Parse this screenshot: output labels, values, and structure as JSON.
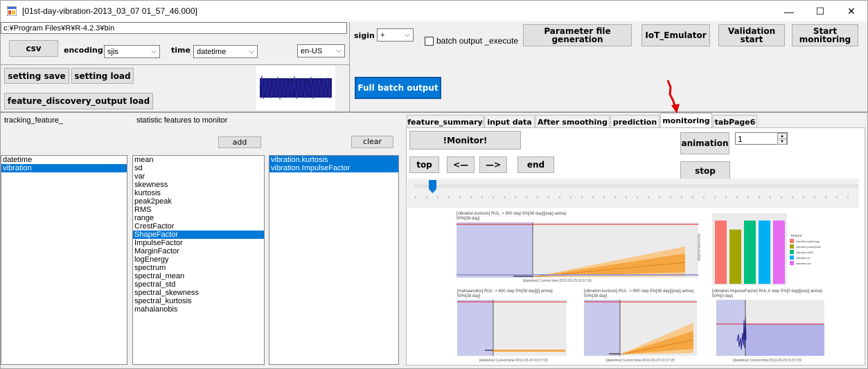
{
  "window": {
    "title": "[01st-day-vibration-2013_03_07 01_57_46.000]"
  },
  "path": {
    "value": "c:¥Program Files¥R¥R-4.2.3¥bin"
  },
  "buttons": {
    "csv": "csv",
    "setting_save": "setting save",
    "setting_load": "setting load",
    "feature_discovery_load": "feature_discovery_output load",
    "full_batch_output": "Full batch output",
    "parameter_file": "Parameter file generation",
    "iot_emulator": "IoT_Emulator",
    "validation_start": "Validation start",
    "start_monitoring": "Start monitoring",
    "add": "add",
    "clear": "clear",
    "monitor": "!Monitor!",
    "top": "top",
    "prev": "<—",
    "next": "—>",
    "end": "end",
    "animation": "animation",
    "stop": "stop"
  },
  "labels": {
    "encoding": "encoding",
    "time": "time",
    "sigin": "sigin",
    "batch_output": "batch output _execute",
    "tracking_feature": "tracking_feature_",
    "statistic_features": "statistic features to monitor"
  },
  "selects": {
    "encoding": "sjis",
    "time": "datetime",
    "locale": "en-US",
    "sigin": "+"
  },
  "tabs": [
    "feature_summary",
    "input data",
    "After smoothing",
    "prediction",
    "monitoring",
    "tabPage6"
  ],
  "active_tab": "monitoring",
  "spinner": {
    "value": "1"
  },
  "slider": {
    "position_fraction": 0.03
  },
  "lists": {
    "tracking": [
      {
        "label": "datetime",
        "selected": false
      },
      {
        "label": "vibration",
        "selected": true
      }
    ],
    "statistics": [
      {
        "label": "mean",
        "selected": false
      },
      {
        "label": "sd",
        "selected": false
      },
      {
        "label": "var",
        "selected": false
      },
      {
        "label": "skewness",
        "selected": false
      },
      {
        "label": "kurtosis",
        "selected": false
      },
      {
        "label": "peak2peak",
        "selected": false
      },
      {
        "label": "RMS",
        "selected": false
      },
      {
        "label": "range",
        "selected": false
      },
      {
        "label": "CrestFactor",
        "selected": false
      },
      {
        "label": "ShapeFactor",
        "selected": true
      },
      {
        "label": "ImpulseFactor",
        "selected": false
      },
      {
        "label": "MarginFactor",
        "selected": false
      },
      {
        "label": "logEnergy",
        "selected": false
      },
      {
        "label": "spectrum",
        "selected": false
      },
      {
        "label": "spectral_mean",
        "selected": false
      },
      {
        "label": "spectral_std",
        "selected": false
      },
      {
        "label": "spectral_skewness",
        "selected": false
      },
      {
        "label": "spectral_kurtosis",
        "selected": false
      },
      {
        "label": "mahalanobis",
        "selected": false
      }
    ],
    "monitored": [
      {
        "label": "vibration.kurtosis",
        "selected": true
      },
      {
        "label": "vibration.ImpulseFactor",
        "selected": true
      }
    ]
  },
  "plots": {
    "top_left": {
      "title": "[vibration.kurtosis] RUL: > 800 step 5%[38 day]|[exp] arima)",
      "subtitle": "50%[38 day]",
      "xlabel": "[datetime] Current time:2013-03-23 01:57:29"
    },
    "bar": {
      "ylabel": "abs(monotonicity)",
      "legend_title": "feature",
      "legend": [
        {
          "label": "vibration.logEnergy",
          "color": "#f8766d"
        },
        {
          "label": "vibration.peak2peak",
          "color": "#a3a500"
        },
        {
          "label": "vibration.RMS",
          "color": "#00bf7d"
        },
        {
          "label": "vibration.sd",
          "color": "#00b0f6"
        },
        {
          "label": "vibration.var",
          "color": "#e76bf3"
        }
      ],
      "values": [
        0.42,
        0.36,
        0.42,
        0.42,
        0.42
      ]
    },
    "bottom_1": {
      "title": "[mahalanobis] RUL: > 800 step 5%[38 day]|[] arima)",
      "subtitle": "50%[38 day]",
      "xlabel": "[datetime] Current time:2013-03-23 01:57:29"
    },
    "bottom_2": {
      "title": "[vibration.kurtosis] RUL: > 800 step 5%[38 day]|[exp] arima)",
      "subtitle": "50%[38 day]",
      "xlabel": "[datetime] Current time:2013-03-23 01:57:29"
    },
    "bottom_3": {
      "title": "[vibration.ImpulseFactor] RUL:0 step 5%[0 day]|[exp] arima)",
      "subtitle": "50%[0 day]",
      "xlabel": "[datetime] Current time:2013-03-23 01:57:29"
    }
  },
  "colors": {
    "accent": "#0078d7",
    "threshold_line": "#e31a1c",
    "forecast_band": "#f5a742",
    "history_band": "#b3b3ea"
  }
}
